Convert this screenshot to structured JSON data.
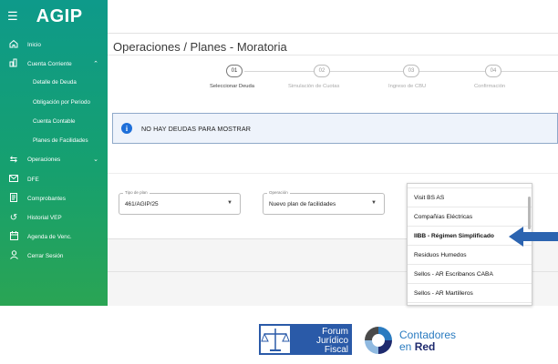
{
  "sidebar": {
    "logo": "AGIP",
    "menu_icon": "hamburger-icon",
    "items": [
      {
        "label": "Inicio",
        "icon": "home-icon"
      },
      {
        "label": "Cuenta Corriente",
        "icon": "account-icon"
      },
      {
        "label": "Operaciones",
        "icon": "transfer-icon"
      },
      {
        "label": "DFE",
        "icon": "mail-icon"
      },
      {
        "label": "Comprobantes",
        "icon": "receipt-icon"
      },
      {
        "label": "Historial VEP",
        "icon": "history-icon"
      },
      {
        "label": "Agenda de Venc.",
        "icon": "calendar-icon"
      },
      {
        "label": "Cerrar Sesión",
        "icon": "user-icon"
      }
    ],
    "sub_items": [
      {
        "label": "Detalle de Deuda"
      },
      {
        "label": "Obligación por Periodo"
      },
      {
        "label": "Cuenta Contable"
      },
      {
        "label": "Planes de Facilidades"
      }
    ]
  },
  "header": {
    "title": "Operaciones / Planes - Moratoria"
  },
  "stepper": {
    "steps": [
      {
        "number": "01",
        "label": "Seleccionar Deuda"
      },
      {
        "number": "02",
        "label": "Simulación de Cuotas"
      },
      {
        "number": "03",
        "label": "Ingreso de CBU"
      },
      {
        "number": "04",
        "label": "Confirmación"
      }
    ]
  },
  "alert": {
    "icon": "info-icon",
    "text": "NO HAY DEUDAS PARA MOSTRAR"
  },
  "form": {
    "tipo_plan": {
      "label": "Tipo de plan",
      "value": "461/AGIP/25"
    },
    "operacion": {
      "label": "Operación",
      "value": "Nuevo plan de facilidades"
    }
  },
  "dropdown": {
    "options": [
      {
        "label": "Visit BS AS"
      },
      {
        "label": "Compañías Eléctricas"
      },
      {
        "label": "IIBB - Régimen Simplificado"
      },
      {
        "label": "Residuos Humedos"
      },
      {
        "label": "Sellos - AR Escribanos CABA"
      },
      {
        "label": "Sellos - AR Martilleros"
      }
    ]
  },
  "logos": {
    "forum": {
      "line1": "Forum",
      "line2": "Jurídico",
      "line3": "Fiscal"
    },
    "contadores": {
      "line1": "Contadores",
      "line2_prefix": "en ",
      "line2_bold": "Red"
    }
  },
  "colors": {
    "sidebar_top": "#0e9a8a",
    "sidebar_bottom": "#2aa454",
    "alert_bg": "#eef3fb",
    "info_blue": "#1e6fd9",
    "arrow_blue": "#2c64b0",
    "forum_blue": "#2a5aa8",
    "contadores_blue": "#2a7bc0"
  }
}
